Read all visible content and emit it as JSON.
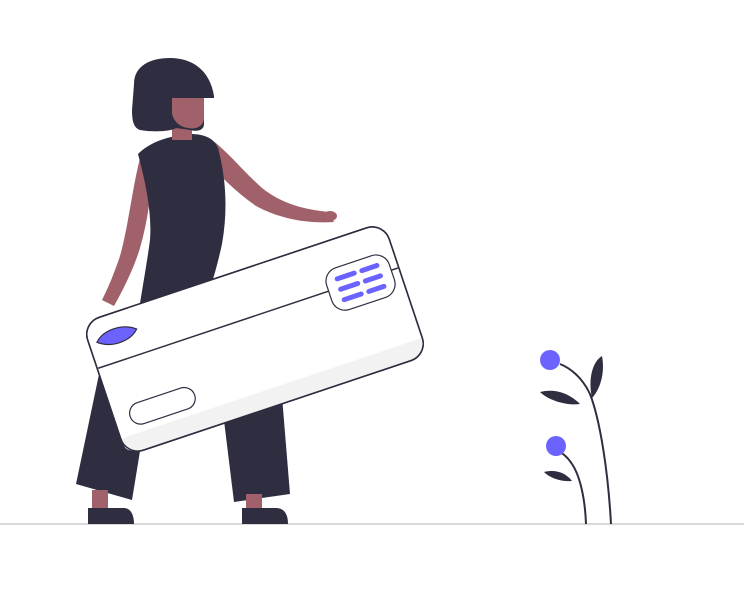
{
  "illustration": {
    "subject": "woman-holding-credit-card",
    "elements": [
      "woman",
      "credit-card",
      "plant",
      "ground-line"
    ]
  },
  "colors": {
    "background": "#ffffff",
    "dark": "#2f2e41",
    "skin": "#a0616a",
    "accent": "#6c63ff",
    "card_fill": "#ffffff",
    "card_shade": "#f2f2f2",
    "ground": "#cccccc"
  }
}
